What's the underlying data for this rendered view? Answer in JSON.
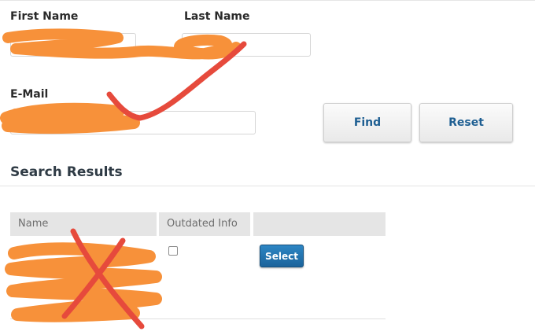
{
  "form": {
    "first_name_label": "First Name",
    "last_name_label": "Last Name",
    "email_label": "E-Mail",
    "find_label": "Find",
    "reset_label": "Reset"
  },
  "results": {
    "title": "Search Results",
    "columns": [
      "Name",
      "Outdated Info",
      ""
    ],
    "rows": [
      {
        "name": "",
        "outdated_info": false,
        "action_label": "Select"
      }
    ]
  },
  "colors": {
    "accent": "#1f5f92",
    "button_primary": "#2273af",
    "scribble_orange": "#f7913a",
    "scribble_red": "#e64a3c"
  }
}
